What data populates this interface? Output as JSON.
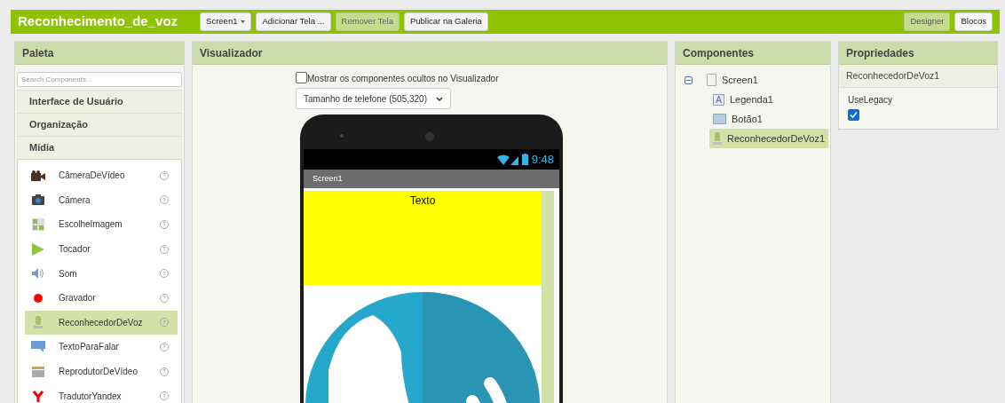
{
  "project_title": "Reconhecimento_de_voz",
  "toolbar": [
    {
      "label": "Screen1",
      "kind": "dropdown",
      "disabled": false
    },
    {
      "label": "Adicionar Tela ...",
      "kind": "button",
      "disabled": false
    },
    {
      "label": "Remover Tela",
      "kind": "button",
      "disabled": true
    },
    {
      "label": "Publicar na Galeria",
      "kind": "button",
      "disabled": false
    }
  ],
  "view_switch": [
    {
      "label": "Designer",
      "selected": true
    },
    {
      "label": "Blocos",
      "selected": false
    }
  ],
  "palette": {
    "title": "Paleta",
    "search": {
      "placeholder": "Search Components..."
    },
    "categories": [
      {
        "label": "Interface de Usuário"
      },
      {
        "label": "Organização"
      },
      {
        "label": "Mídia"
      }
    ],
    "items": [
      {
        "label": "CâmeraDeVídeo",
        "selected": false,
        "help": "?"
      },
      {
        "label": "Câmera",
        "selected": false,
        "help": "?"
      },
      {
        "label": "EscolheImagem",
        "selected": false,
        "help": "?"
      },
      {
        "label": "Tocador",
        "selected": false,
        "help": "?"
      },
      {
        "label": "Som",
        "selected": false,
        "help": "?"
      },
      {
        "label": "Gravador",
        "selected": false,
        "help": "?"
      },
      {
        "label": "ReconhecedorDeVoz",
        "selected": true,
        "help": "?"
      },
      {
        "label": "TextoParaFalar",
        "selected": false,
        "help": "?"
      },
      {
        "label": "ReprodutorDeVídeo",
        "selected": false,
        "help": "?"
      },
      {
        "label": "TradutorYandex",
        "selected": false,
        "help": "?"
      }
    ]
  },
  "viewer": {
    "title": "Visualizador",
    "show_hidden": {
      "label": "Mostrar os componentes ocultos no Visualizador",
      "checked": false
    },
    "size_select": {
      "value": "Tamanho de telefone (505,320)"
    },
    "phone": {
      "time": "9:48",
      "screen_title": "Screen1",
      "label_text": "Texto"
    }
  },
  "components": {
    "title": "Componentes",
    "tree": [
      {
        "label": "Screen1",
        "expanded": true,
        "selected": false,
        "children": [
          {
            "label": "Legenda1",
            "selected": false,
            "icon_letter": "A"
          },
          {
            "label": "Botão1",
            "selected": false
          },
          {
            "label": "ReconhecedorDeVoz1",
            "selected": true
          }
        ]
      }
    ]
  },
  "properties": {
    "title": "Propriedades",
    "component": "ReconhecedorDeVoz1",
    "items": [
      {
        "label": "UseLegacy",
        "checked": true
      }
    ]
  }
}
